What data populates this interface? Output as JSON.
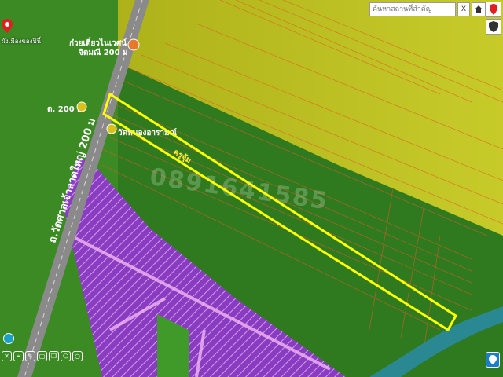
{
  "map": {
    "search_placeholder": "ค้นหาสถานที่สำคัญ",
    "clear_label": "X",
    "road_label": "ถ.วัดศาลเจ้าลาดใหญ่ 200 ม",
    "places": [
      {
        "label": "ก๋วยเตี๋ยวไนเวศน์"
      },
      {
        "label": "จิตมณี 200 ม"
      },
      {
        "label": "ต. 200 ม"
      },
      {
        "label": "วัดหนองอารามณ์"
      }
    ],
    "plot_label": "ครูจุ้ม",
    "watermark": "0891641585",
    "pin_label": "ผังเมืองของปีนี้",
    "colors": {
      "plot_outline": "#ffff00",
      "agri_green": "#2f7a1e",
      "yellow_zone": "#c8c81e",
      "purple_zone": "#9b3fd6",
      "road": "#8a8a8a",
      "river": "#2a8aa0"
    }
  }
}
